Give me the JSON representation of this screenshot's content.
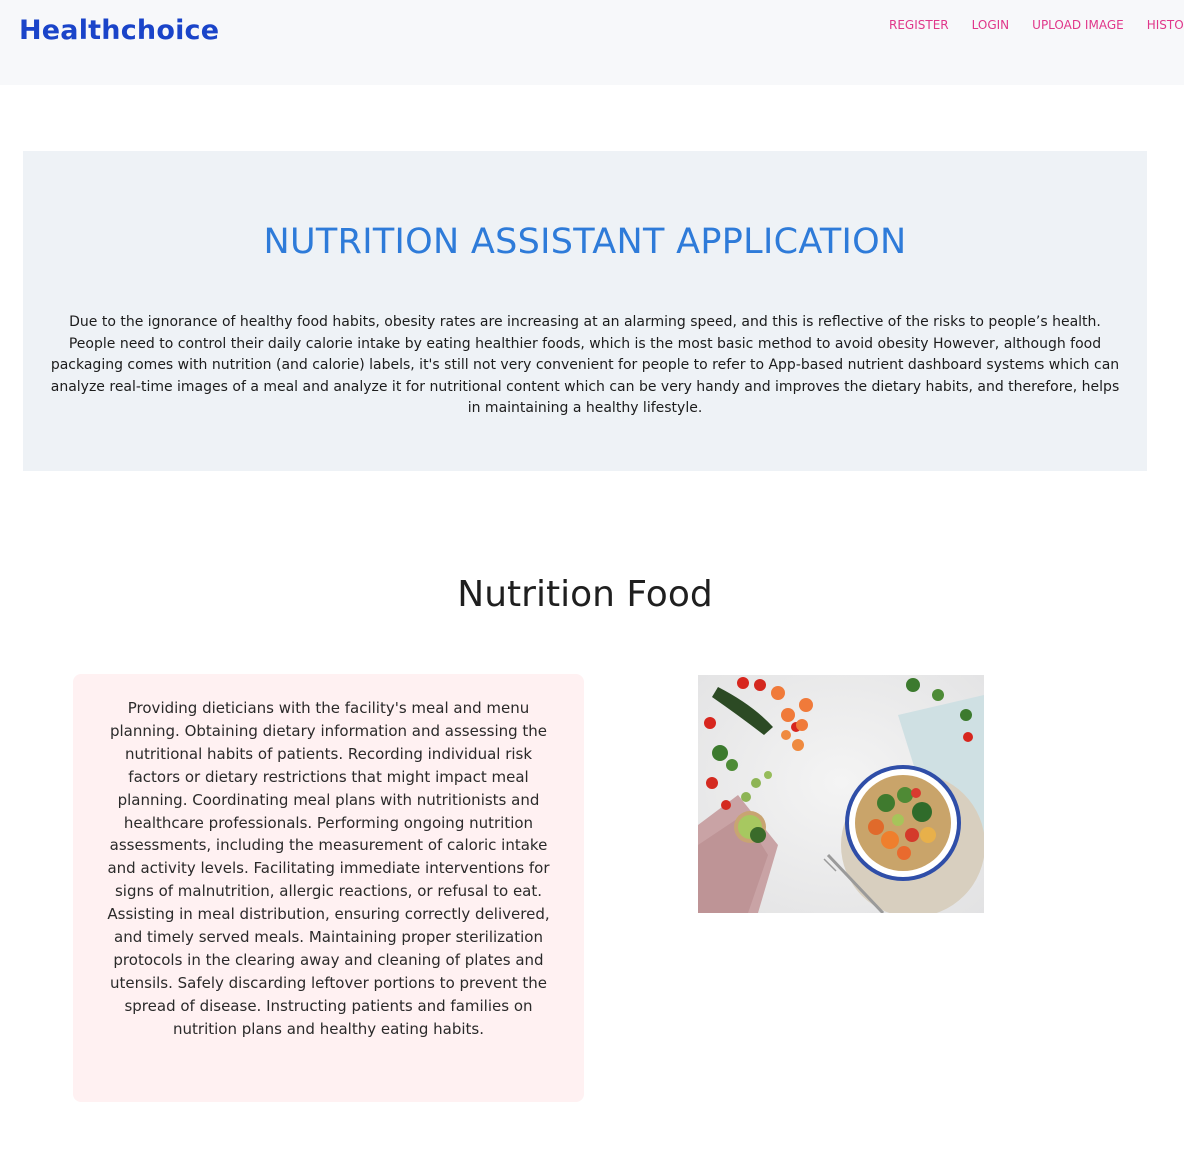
{
  "brand": {
    "name": "Healthchoice"
  },
  "nav": {
    "items": [
      {
        "label": "REGISTER"
      },
      {
        "label": "LOGIN"
      },
      {
        "label": "UPLOAD IMAGE"
      },
      {
        "label": "HISTORY"
      }
    ]
  },
  "hero": {
    "title": "NUTRITION ASSISTANT APPLICATION",
    "description": "Due to the ignorance of healthy food habits, obesity rates are increasing at an alarming speed, and this is reflective of the risks to people’s health. People need to control their daily calorie intake by eating healthier foods, which is the most basic method to avoid obesity However, although food packaging comes with nutrition (and calorie) labels, it's still not very convenient for people to refer to App-based nutrient dashboard systems which can analyze real-time images of a meal and analyze it for nutritional content which can be very handy and improves the dietary habits, and therefore, helps in maintaining a healthy lifestyle."
  },
  "section": {
    "title": "Nutrition Food",
    "card_text": "Providing dieticians with the facility's meal and menu planning. Obtaining dietary information and assessing the nutritional habits of patients. Recording individual risk factors or dietary restrictions that might impact meal planning. Coordinating meal plans with nutritionists and healthcare professionals. Performing ongoing nutrition assessments, including the measurement of caloric intake and activity levels. Facilitating immediate interventions for signs of malnutrition, allergic reactions, or refusal to eat. Assisting in meal distribution, ensuring correctly delivered, and timely served meals. Maintaining proper sterilization protocols in the clearing away and cleaning of plates and utensils. Safely discarding leftover portions to prevent the spread of disease. Instructing patients and families on nutrition plans and healthy eating habits.",
    "image_icon": "healthy-food-photo"
  },
  "colors": {
    "brand": "#1a44c9",
    "nav_link": "#e0368a",
    "hero_title": "#2e7bd9",
    "hero_bg": "#eef2f6",
    "card_bg": "#fff1f2"
  }
}
